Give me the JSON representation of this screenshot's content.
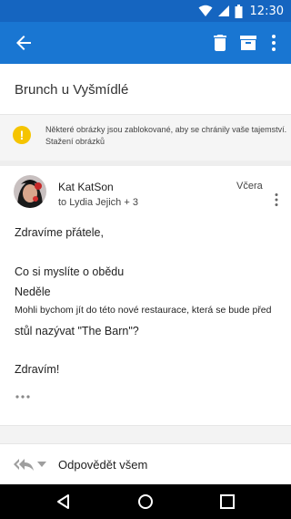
{
  "status_bar": {
    "time": "12:30",
    "icons": [
      "wifi-icon",
      "signal-icon",
      "battery-icon"
    ]
  },
  "app_bar": {
    "back_icon": "arrow-back-icon",
    "actions": [
      "delete-icon",
      "archive-icon",
      "more-vert-icon"
    ],
    "color": "#1976d2"
  },
  "message": {
    "subject": "Brunch u Vyšmídlé",
    "warning": {
      "icon": "warning-icon",
      "text": "Některé obrázky jsou zablokované, aby se chránily vaše tajemství.",
      "action": "Stažení obrázků"
    },
    "sender": {
      "name": "Kat KatSon",
      "recipients": "to Lydia Jejich + 3",
      "date": "Včera"
    },
    "body": {
      "greeting": "Zdravíme přátele,",
      "line1": "Co si myslíte o obědu",
      "line2": "Neděle",
      "line3": "Mohli bychom jít do této nové restaurace, která se bude před",
      "line4": "stůl nazývat \"The Barn\"?",
      "closing": "Zdravím!"
    }
  },
  "reply": {
    "label": "Odpovědět všem"
  },
  "colors": {
    "app_bar": "#1976d2",
    "status_bar": "#1565c0",
    "warning": "#f5c400"
  }
}
